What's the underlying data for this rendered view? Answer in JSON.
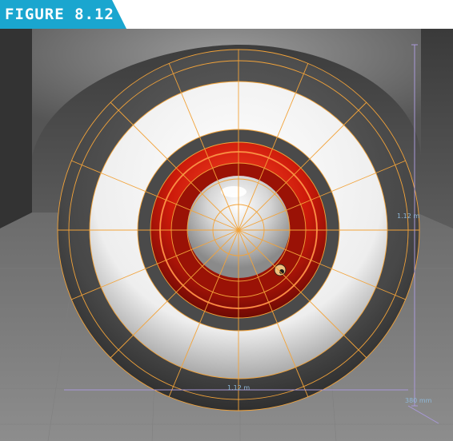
{
  "figure": {
    "label": "FIGURE 8.12",
    "tab_color": "#1aa6cf"
  },
  "viewport": {
    "dimension_labels": {
      "right_height": "1.12 m",
      "bottom_width": "1.12 m",
      "bottom_right_depth": "380 mm"
    },
    "colors": {
      "wireframe": "#f2a33a",
      "rim_red": "#d81e0e",
      "tire_dark": "#4a4a4a",
      "whitewall": "#f2f2f2",
      "measure_line": "#a999d8"
    }
  }
}
